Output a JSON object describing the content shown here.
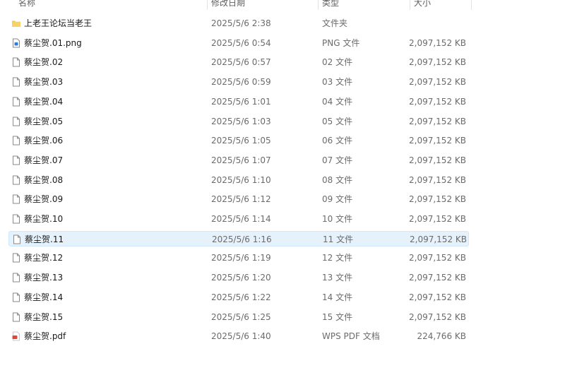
{
  "headers": {
    "name": "名称",
    "date": "修改日期",
    "type": "类型",
    "size": "大小"
  },
  "files": [
    {
      "name": "上老王论坛当老王",
      "date": "2025/5/6 2:38",
      "type": "文件夹",
      "size": "",
      "icon": "folder-icon"
    },
    {
      "name": "蔡尘贺.01.png",
      "date": "2025/5/6 0:54",
      "type": "PNG 文件",
      "size": "2,097,152 KB",
      "icon": "image-file-icon"
    },
    {
      "name": "蔡尘贺.02",
      "date": "2025/5/6 0:57",
      "type": "02 文件",
      "size": "2,097,152 KB",
      "icon": "file-icon"
    },
    {
      "name": "蔡尘贺.03",
      "date": "2025/5/6 0:59",
      "type": "03 文件",
      "size": "2,097,152 KB",
      "icon": "file-icon"
    },
    {
      "name": "蔡尘贺.04",
      "date": "2025/5/6 1:01",
      "type": "04 文件",
      "size": "2,097,152 KB",
      "icon": "file-icon"
    },
    {
      "name": "蔡尘贺.05",
      "date": "2025/5/6 1:03",
      "type": "05 文件",
      "size": "2,097,152 KB",
      "icon": "file-icon"
    },
    {
      "name": "蔡尘贺.06",
      "date": "2025/5/6 1:05",
      "type": "06 文件",
      "size": "2,097,152 KB",
      "icon": "file-icon"
    },
    {
      "name": "蔡尘贺.07",
      "date": "2025/5/6 1:07",
      "type": "07 文件",
      "size": "2,097,152 KB",
      "icon": "file-icon"
    },
    {
      "name": "蔡尘贺.08",
      "date": "2025/5/6 1:10",
      "type": "08 文件",
      "size": "2,097,152 KB",
      "icon": "file-icon"
    },
    {
      "name": "蔡尘贺.09",
      "date": "2025/5/6 1:12",
      "type": "09 文件",
      "size": "2,097,152 KB",
      "icon": "file-icon"
    },
    {
      "name": "蔡尘贺.10",
      "date": "2025/5/6 1:14",
      "type": "10 文件",
      "size": "2,097,152 KB",
      "icon": "file-icon"
    },
    {
      "name": "蔡尘贺.11",
      "date": "2025/5/6 1:16",
      "type": "11 文件",
      "size": "2,097,152 KB",
      "icon": "file-icon",
      "selected": true
    },
    {
      "name": "蔡尘贺.12",
      "date": "2025/5/6 1:19",
      "type": "12 文件",
      "size": "2,097,152 KB",
      "icon": "file-icon"
    },
    {
      "name": "蔡尘贺.13",
      "date": "2025/5/6 1:20",
      "type": "13 文件",
      "size": "2,097,152 KB",
      "icon": "file-icon"
    },
    {
      "name": "蔡尘贺.14",
      "date": "2025/5/6 1:22",
      "type": "14 文件",
      "size": "2,097,152 KB",
      "icon": "file-icon"
    },
    {
      "name": "蔡尘贺.15",
      "date": "2025/5/6 1:25",
      "type": "15 文件",
      "size": "2,097,152 KB",
      "icon": "file-icon"
    },
    {
      "name": "蔡尘贺.pdf",
      "date": "2025/5/6 1:40",
      "type": "WPS PDF 文档",
      "size": "224,766 KB",
      "icon": "pdf-file-icon"
    }
  ],
  "colors": {
    "selected_bg": "#e5f1fb",
    "folder": "#f2c94c",
    "pdf": "#e0443a",
    "png": "#2f7bd8"
  }
}
